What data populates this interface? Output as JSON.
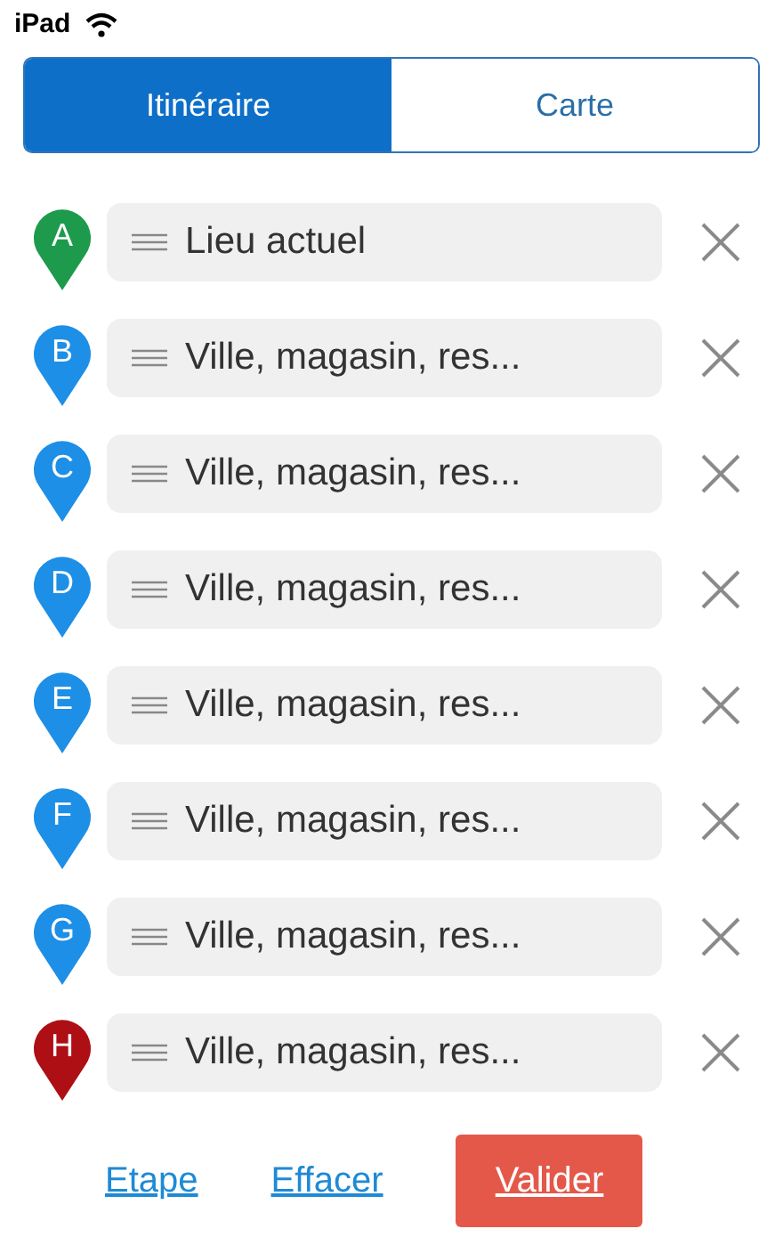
{
  "status_bar": {
    "device": "iPad"
  },
  "tabs": [
    {
      "label": "Itinéraire",
      "selected": true
    },
    {
      "label": "Carte",
      "selected": false
    }
  ],
  "stops": [
    {
      "letter": "A",
      "color": "#1e9a4c",
      "value": "Lieu actuel"
    },
    {
      "letter": "B",
      "color": "#1d8fe6",
      "value": "Ville, magasin, res..."
    },
    {
      "letter": "C",
      "color": "#1d8fe6",
      "value": "Ville, magasin, res..."
    },
    {
      "letter": "D",
      "color": "#1d8fe6",
      "value": "Ville, magasin, res..."
    },
    {
      "letter": "E",
      "color": "#1d8fe6",
      "value": "Ville, magasin, res..."
    },
    {
      "letter": "F",
      "color": "#1d8fe6",
      "value": "Ville, magasin, res..."
    },
    {
      "letter": "G",
      "color": "#1d8fe6",
      "value": "Ville, magasin, res..."
    },
    {
      "letter": "H",
      "color": "#ad0f14",
      "value": "Ville, magasin, res..."
    }
  ],
  "actions": [
    {
      "label": "Etape",
      "kind": "link"
    },
    {
      "label": "Effacer",
      "kind": "link"
    },
    {
      "label": "Valider",
      "kind": "primary"
    }
  ]
}
